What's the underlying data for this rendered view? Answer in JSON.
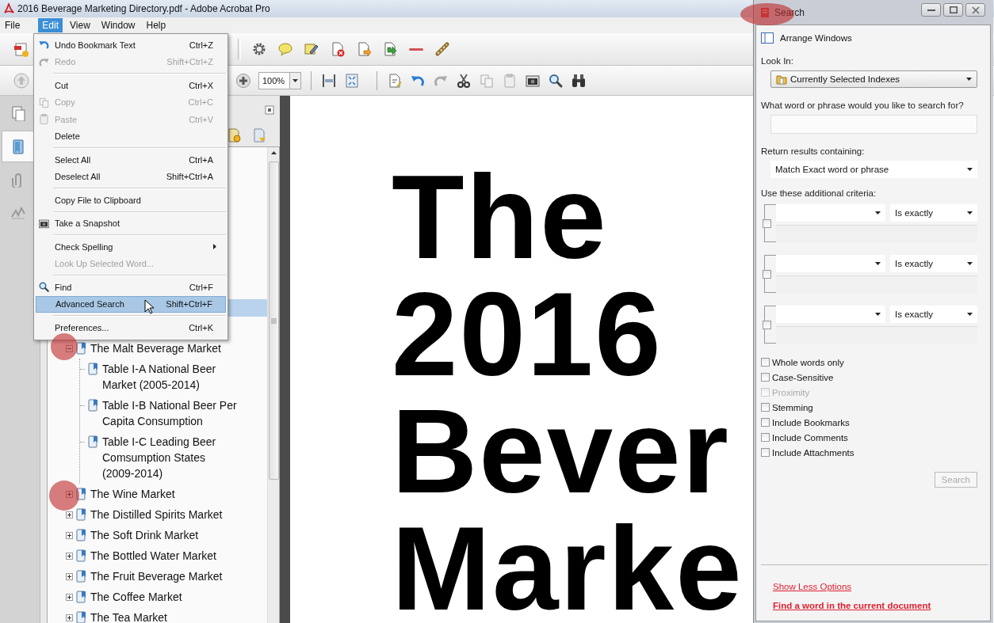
{
  "window": {
    "title": "2016 Beverage Marketing Directory.pdf - Adobe Acrobat Pro"
  },
  "menu_bar": [
    {
      "label": "File",
      "selected": false
    },
    {
      "label": "Edit",
      "selected": true
    },
    {
      "label": "View",
      "selected": false
    },
    {
      "label": "Window",
      "selected": false
    },
    {
      "label": "Help",
      "selected": false
    }
  ],
  "edit_menu": {
    "groups": [
      [
        {
          "label": "Undo Bookmark Text",
          "shortcut": "Ctrl+Z",
          "kind": "undo",
          "disabled": false,
          "selected": false,
          "submenu": false
        },
        {
          "label": "Redo",
          "shortcut": "Shift+Ctrl+Z",
          "kind": "redo",
          "disabled": true,
          "selected": false,
          "submenu": false
        }
      ],
      [
        {
          "label": "Cut",
          "shortcut": "Ctrl+X",
          "kind": "plain",
          "disabled": false,
          "selected": false,
          "submenu": false
        },
        {
          "label": "Copy",
          "shortcut": "Ctrl+C",
          "kind": "copy",
          "disabled": true,
          "selected": false,
          "submenu": false
        },
        {
          "label": "Paste",
          "shortcut": "Ctrl+V",
          "kind": "paste",
          "disabled": true,
          "selected": false,
          "submenu": false
        },
        {
          "label": "Delete",
          "kind": "plain",
          "disabled": false,
          "selected": false,
          "submenu": false
        }
      ],
      [
        {
          "label": "Select All",
          "shortcut": "Ctrl+A",
          "kind": "plain",
          "disabled": false,
          "selected": false,
          "submenu": false
        },
        {
          "label": "Deselect All",
          "shortcut": "Shift+Ctrl+A",
          "kind": "plain",
          "disabled": false,
          "selected": false,
          "submenu": false
        }
      ],
      [
        {
          "label": "Copy File to Clipboard",
          "kind": "plain",
          "disabled": false,
          "selected": false,
          "submenu": false
        }
      ],
      [
        {
          "label": "Take a Snapshot",
          "kind": "snapshot",
          "disabled": false,
          "selected": false,
          "submenu": false
        }
      ],
      [
        {
          "label": "Check Spelling",
          "kind": "plain",
          "disabled": false,
          "selected": false,
          "submenu": true
        },
        {
          "label": "Look Up Selected Word...",
          "kind": "plain",
          "disabled": true,
          "selected": false,
          "submenu": false
        }
      ],
      [
        {
          "label": "Find",
          "shortcut": "Ctrl+F",
          "kind": "find",
          "disabled": false,
          "selected": false,
          "submenu": false
        },
        {
          "label": "Advanced Search",
          "shortcut": "Shift+Ctrl+F",
          "kind": "plain",
          "disabled": false,
          "selected": true,
          "submenu": false
        }
      ],
      [
        {
          "label": "Preferences...",
          "shortcut": "Ctrl+K",
          "kind": "plain",
          "disabled": false,
          "selected": false,
          "submenu": false
        }
      ]
    ]
  },
  "zoom_field": {
    "value": "100%"
  },
  "bookmarks": {
    "highlighted_row": true,
    "items": [
      {
        "label": "The Malt Beverage Market",
        "expanded": true,
        "children": [
          {
            "label": "Table I-A National Beer Market (2005-2014)"
          },
          {
            "label": "Table I-B National Beer Per Capita Consumption"
          },
          {
            "label": "Table I-C Leading Beer Comsumption States (2009-2014)"
          }
        ]
      },
      {
        "label": "The Wine Market",
        "expanded": false
      },
      {
        "label": "The Distilled Spirits Market",
        "expanded": false
      },
      {
        "label": "The Soft Drink Market",
        "expanded": false
      },
      {
        "label": "The Bottled Water Market",
        "expanded": false
      },
      {
        "label": "The Fruit Beverage Market",
        "expanded": false
      },
      {
        "label": "The Coffee Market",
        "expanded": false
      },
      {
        "label": "The Tea Market",
        "expanded": false
      }
    ]
  },
  "document": {
    "lines": [
      "The",
      "2016",
      "Bever",
      "Marke"
    ]
  },
  "search_window": {
    "title": "Search",
    "arrange_windows": "Arrange Windows",
    "look_in_label": "Look In:",
    "look_in": "Currently Selected Indexes",
    "query_label": "What word or phrase would you like to search for?",
    "return_label": "Return results containing:",
    "return_option": "Match Exact word or phrase",
    "criteria_label": "Use these additional criteria:",
    "criteria": [
      {
        "checked": false,
        "operator": "Is exactly"
      },
      {
        "checked": false,
        "operator": "Is exactly"
      },
      {
        "checked": false,
        "operator": "Is exactly"
      }
    ],
    "options": [
      {
        "label": "Whole words only",
        "checked": false,
        "disabled": false
      },
      {
        "label": "Case-Sensitive",
        "checked": false,
        "disabled": false
      },
      {
        "label": "Proximity",
        "checked": false,
        "disabled": true
      },
      {
        "label": "Stemming",
        "checked": false,
        "disabled": false
      },
      {
        "label": "Include Bookmarks",
        "checked": false,
        "disabled": false
      },
      {
        "label": "Include Comments",
        "checked": false,
        "disabled": false
      },
      {
        "label": "Include Attachments",
        "checked": false,
        "disabled": false
      }
    ],
    "search_button": {
      "label": "Search",
      "disabled": true
    },
    "links": [
      {
        "label": "Show Less Options",
        "bold": false
      },
      {
        "label": "Find a word in the current document",
        "bold": true
      }
    ]
  }
}
